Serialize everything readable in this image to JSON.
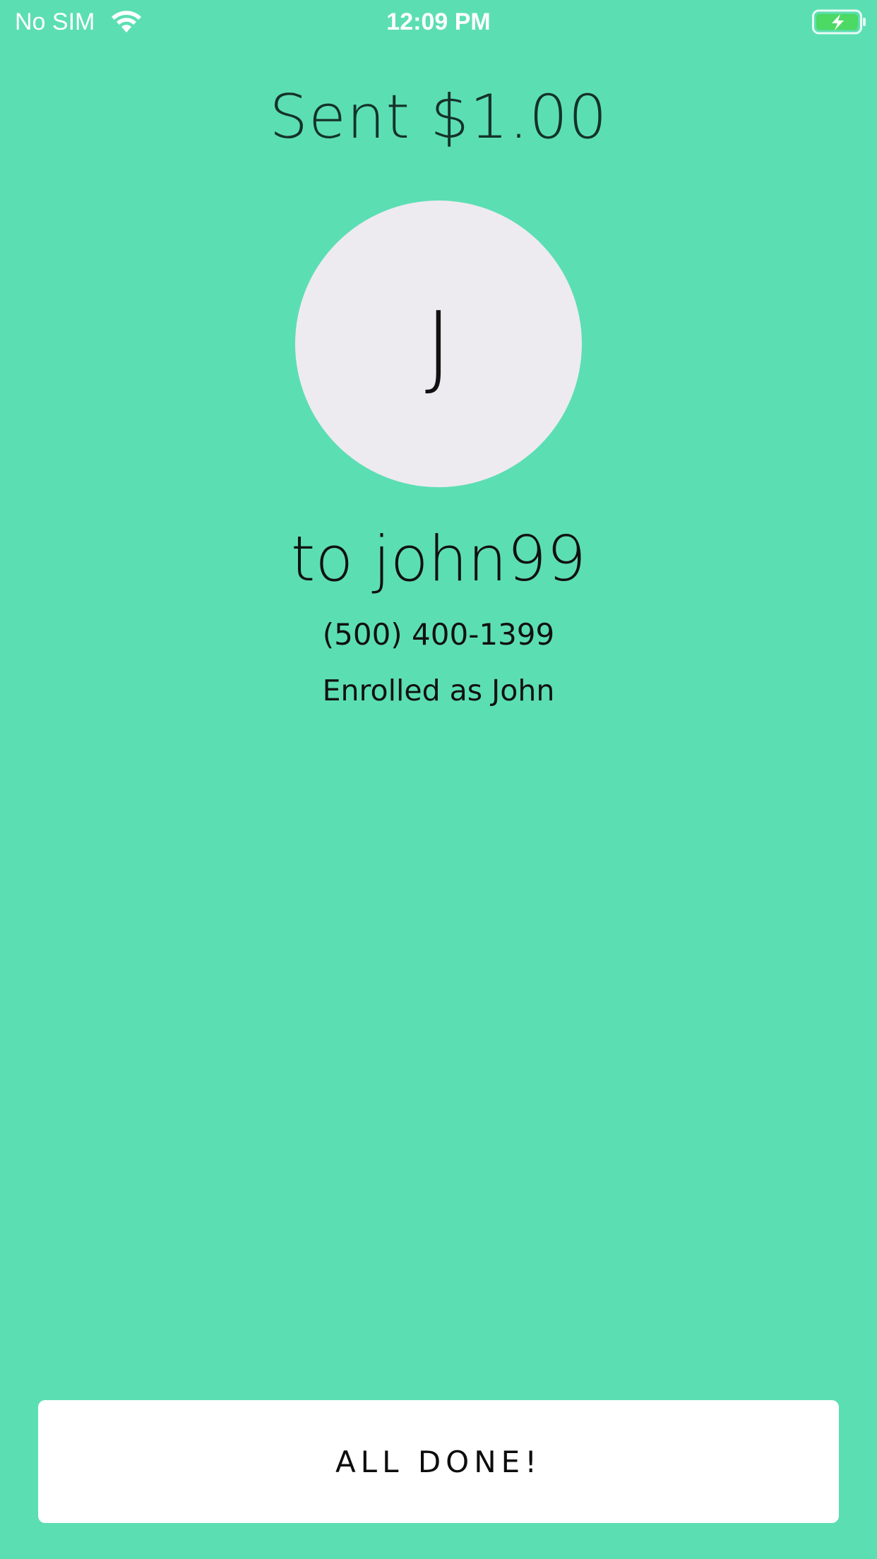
{
  "status_bar": {
    "carrier": "No SIM",
    "time": "12:09 PM",
    "wifi_icon": "wifi-icon",
    "battery_icon": "battery-charging-icon",
    "battery_color": "#4cd964"
  },
  "confirmation": {
    "title": "Sent $1.00",
    "avatar_initial": "J",
    "recipient": "to john99",
    "phone": "(500) 400-1399",
    "enrolled": "Enrolled as John"
  },
  "actions": {
    "done_label": "ALL DONE!"
  },
  "colors": {
    "background": "#5cdeb3",
    "avatar_bg": "#eeebf0",
    "button_bg": "#ffffff"
  }
}
